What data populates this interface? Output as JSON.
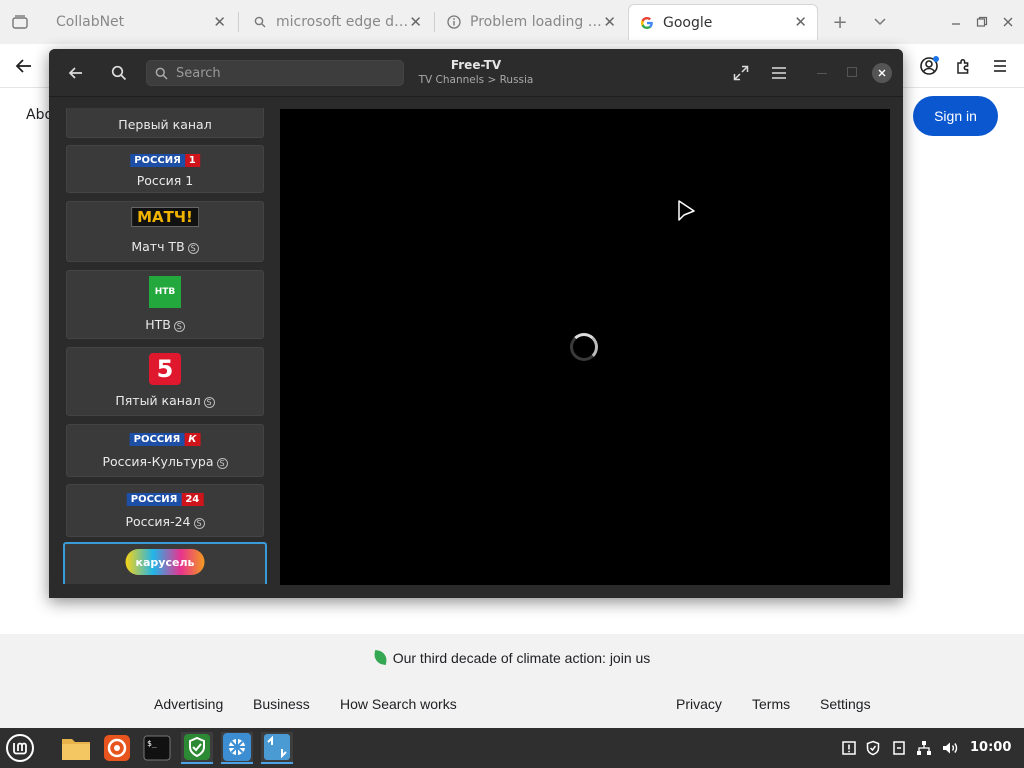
{
  "browser": {
    "tabs": [
      {
        "title": "CollabNet",
        "icon": "page-icon",
        "active": false
      },
      {
        "title": "microsoft edge dev - ",
        "icon": "search-icon",
        "active": false
      },
      {
        "title": "Problem loading page",
        "icon": "info-icon",
        "active": false
      },
      {
        "title": "Google",
        "icon": "google-icon",
        "active": true
      }
    ],
    "new_tab": "+",
    "tab_close": "✕"
  },
  "google": {
    "top_left_link": "Abo",
    "signin_label": "Sign in",
    "climate_text": "Our third decade of climate action: join us",
    "footer_links_left": [
      "Advertising",
      "Business",
      "How Search works"
    ],
    "footer_links_right": [
      "Privacy",
      "Terms",
      "Settings"
    ]
  },
  "freetv": {
    "title": "Free-TV",
    "subtitle": "TV Channels > Russia",
    "search_placeholder": "Search",
    "channels": [
      {
        "name": "Первый канал",
        "logo": "",
        "extra": ""
      },
      {
        "name": "Россия 1",
        "logo": "РОССИЯ",
        "logo_suffix": "1",
        "extra": ""
      },
      {
        "name": "Матч ТВ",
        "logo": "МАТЧ!",
        "extra": "S"
      },
      {
        "name": "НТВ",
        "logo": "НТВ",
        "extra": "S"
      },
      {
        "name": "Пятый канал",
        "logo": "5",
        "extra": "S"
      },
      {
        "name": "Россия-Культура",
        "logo": "РОССИЯ",
        "logo_suffix": "К",
        "extra": "S"
      },
      {
        "name": "Россия-24",
        "logo": "РОССИЯ",
        "logo_suffix": "24",
        "extra": "S"
      },
      {
        "name": "",
        "logo": "карусель",
        "extra": ""
      }
    ],
    "player_state": "loading"
  },
  "taskbar": {
    "apps": [
      "mint-menu-icon",
      "files-icon",
      "firefox-icon",
      "terminal-icon",
      "shield-app-icon",
      "kolibri-icon",
      "transfer-icon"
    ],
    "clock": "10:00"
  },
  "colors": {
    "signin_bg": "#0b57d0",
    "selected_border": "#3a9bd9",
    "player_bg": "#000000",
    "taskbar_bg": "#2f2f2f"
  }
}
